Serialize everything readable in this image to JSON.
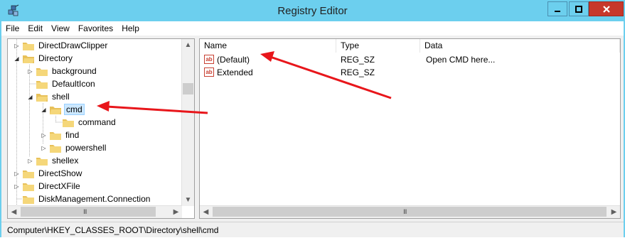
{
  "window": {
    "title": "Registry Editor"
  },
  "menu": [
    "File",
    "Edit",
    "View",
    "Favorites",
    "Help"
  ],
  "tree": {
    "items": [
      {
        "label": "DirectDrawClipper",
        "expander": "▷"
      },
      {
        "label": "Directory",
        "expander": "◢"
      },
      {
        "label": "background",
        "expander": "▷"
      },
      {
        "label": "DefaultIcon",
        "expander": ""
      },
      {
        "label": "shell",
        "expander": "◢"
      },
      {
        "label": "cmd",
        "expander": "◢",
        "selected": true
      },
      {
        "label": "command",
        "expander": ""
      },
      {
        "label": "find",
        "expander": "▷"
      },
      {
        "label": "powershell",
        "expander": "▷"
      },
      {
        "label": "shellex",
        "expander": "▷"
      },
      {
        "label": "DirectShow",
        "expander": "▷"
      },
      {
        "label": "DirectXFile",
        "expander": "▷"
      },
      {
        "label": "DiskManagement.Connection",
        "expander": ""
      }
    ]
  },
  "list": {
    "columns": [
      "Name",
      "Type",
      "Data"
    ],
    "rows": [
      {
        "name": "(Default)",
        "type": "REG_SZ",
        "data": "Open CMD here..."
      },
      {
        "name": "Extended",
        "type": "REG_SZ",
        "data": ""
      }
    ]
  },
  "status": {
    "path": "Computer\\HKEY_CLASSES_ROOT\\Directory\\shell\\cmd"
  },
  "colors": {
    "titlebar": "#6ccfee",
    "close": "#c7382b",
    "selection": "#cce8ff",
    "annotation_arrow": "#e8161b"
  },
  "icons": {
    "app": "registry-cubes-icon",
    "folder": "folder-icon",
    "value": "string-value-icon"
  }
}
